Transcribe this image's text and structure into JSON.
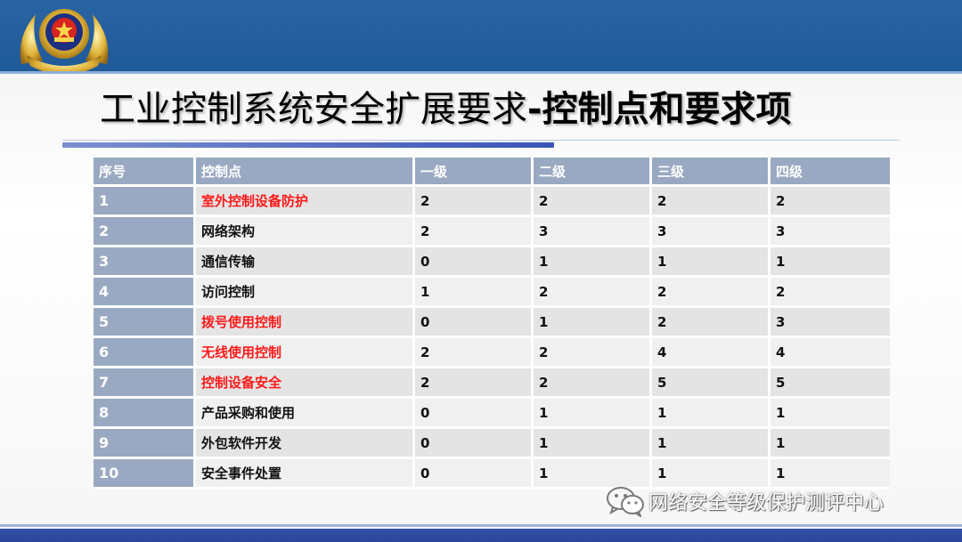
{
  "header": {
    "emblem_icon": "national-police-emblem",
    "title_regular": "工业控制系统安全扩展要求",
    "title_bold": "-控制点和要求项"
  },
  "table": {
    "columns": [
      "序号",
      "控制点",
      "一级",
      "二级",
      "三级",
      "四级"
    ],
    "rows": [
      {
        "no": "1",
        "name": "室外控制设备防护",
        "l1": "2",
        "l2": "2",
        "l3": "2",
        "l4": "2",
        "highlight": true
      },
      {
        "no": "2",
        "name": "网络架构",
        "l1": "2",
        "l2": "3",
        "l3": "3",
        "l4": "3",
        "highlight": false
      },
      {
        "no": "3",
        "name": "通信传输",
        "l1": "0",
        "l2": "1",
        "l3": "1",
        "l4": "1",
        "highlight": false
      },
      {
        "no": "4",
        "name": "访问控制",
        "l1": "1",
        "l2": "2",
        "l3": "2",
        "l4": "2",
        "highlight": false
      },
      {
        "no": "5",
        "name": "拨号使用控制",
        "l1": "0",
        "l2": "1",
        "l3": "2",
        "l4": "3",
        "highlight": true
      },
      {
        "no": "6",
        "name": "无线使用控制",
        "l1": "2",
        "l2": "2",
        "l3": "4",
        "l4": "4",
        "highlight": true
      },
      {
        "no": "7",
        "name": "控制设备安全",
        "l1": "2",
        "l2": "2",
        "l3": "5",
        "l4": "5",
        "highlight": true
      },
      {
        "no": "8",
        "name": "产品采购和使用",
        "l1": "0",
        "l2": "1",
        "l3": "1",
        "l4": "1",
        "highlight": false
      },
      {
        "no": "9",
        "name": "外包软件开发",
        "l1": "0",
        "l2": "1",
        "l3": "1",
        "l4": "1",
        "highlight": false
      },
      {
        "no": "10",
        "name": "安全事件处置",
        "l1": "0",
        "l2": "1",
        "l3": "1",
        "l4": "1",
        "highlight": false
      }
    ],
    "highlight_color": "#ff1a1a"
  },
  "watermark": {
    "icon": "wechat-icon",
    "text": "网络安全等级保护测评中心"
  },
  "colors": {
    "header_blue": "#1f5a99",
    "table_header": "#9aa9c2"
  }
}
